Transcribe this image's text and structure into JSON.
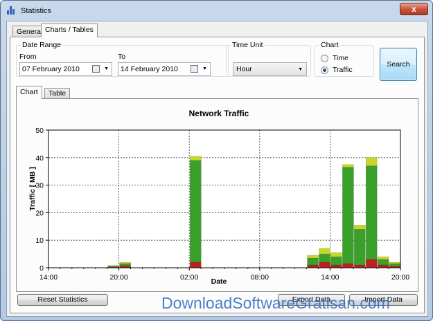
{
  "window": {
    "title": "Statistics",
    "close_label": "x"
  },
  "tabs": [
    {
      "label": "General"
    },
    {
      "label": "Charts / Tables"
    }
  ],
  "date_range": {
    "group_label": "Date Range",
    "from_label": "From",
    "from_value": "07  February  2010",
    "to_label": "To",
    "to_value": "14  February  2010"
  },
  "time_unit": {
    "group_label": "Time Unit",
    "selected": "Hour"
  },
  "chart_option": {
    "group_label": "Chart",
    "options": [
      {
        "label": "Time",
        "selected": false
      },
      {
        "label": "Traffic",
        "selected": true
      }
    ]
  },
  "buttons": {
    "search": "Search",
    "reset": "Reset Statistics",
    "export": "Export Data",
    "import": "Import Data"
  },
  "subtabs": [
    {
      "label": "Chart"
    },
    {
      "label": "Table"
    }
  ],
  "watermark": "DownloadSoftwareGratisan.com",
  "colors": {
    "window_blue": "#b5c9e2",
    "bar_green": "#3aa02a",
    "bar_top": "#c8d62a",
    "bar_red": "#c01f1f",
    "search_border": "#3c7fb1"
  },
  "chart_data": {
    "type": "bar",
    "title": "Network Traffic",
    "xlabel": "Date",
    "ylabel": "Traffic [ MB ]",
    "ylim": [
      0,
      50
    ],
    "yticks": [
      "0",
      "10",
      "20",
      "30",
      "40",
      "50"
    ],
    "xtick_labels": [
      "14:00",
      "20:00",
      "02:00",
      "08:00",
      "14:00",
      "20:00"
    ],
    "grid": true,
    "x_hours": [
      14,
      15,
      16,
      17,
      18,
      19,
      20,
      21,
      22,
      23,
      24,
      25,
      26,
      27,
      28,
      29,
      30,
      31,
      32,
      33,
      34,
      35,
      36,
      37,
      38,
      39,
      40,
      41,
      42,
      43,
      44
    ],
    "series": [
      {
        "values": [
          0,
          0,
          0,
          0,
          0,
          0.3,
          0.8,
          0,
          0,
          0,
          0,
          0,
          2,
          0,
          0,
          0,
          0,
          0,
          0,
          0,
          0,
          0,
          1,
          2,
          1,
          1.5,
          1,
          3,
          1,
          0.5,
          0
        ]
      },
      {
        "values": [
          0,
          0,
          0,
          0,
          0,
          0.3,
          0.7,
          0,
          0,
          0,
          0,
          0,
          37,
          0,
          0,
          0,
          0,
          0,
          0,
          0,
          0,
          0,
          2.5,
          3,
          3,
          35,
          13,
          34,
          2,
          1,
          0
        ]
      },
      {
        "values": [
          0,
          0,
          0,
          0,
          0,
          0.2,
          0.5,
          0,
          0,
          0,
          0,
          0,
          1.5,
          0,
          0,
          0,
          0,
          0,
          0,
          0,
          0,
          0,
          1,
          2,
          1.5,
          1,
          1.5,
          3,
          1,
          0.5,
          0
        ]
      }
    ]
  }
}
